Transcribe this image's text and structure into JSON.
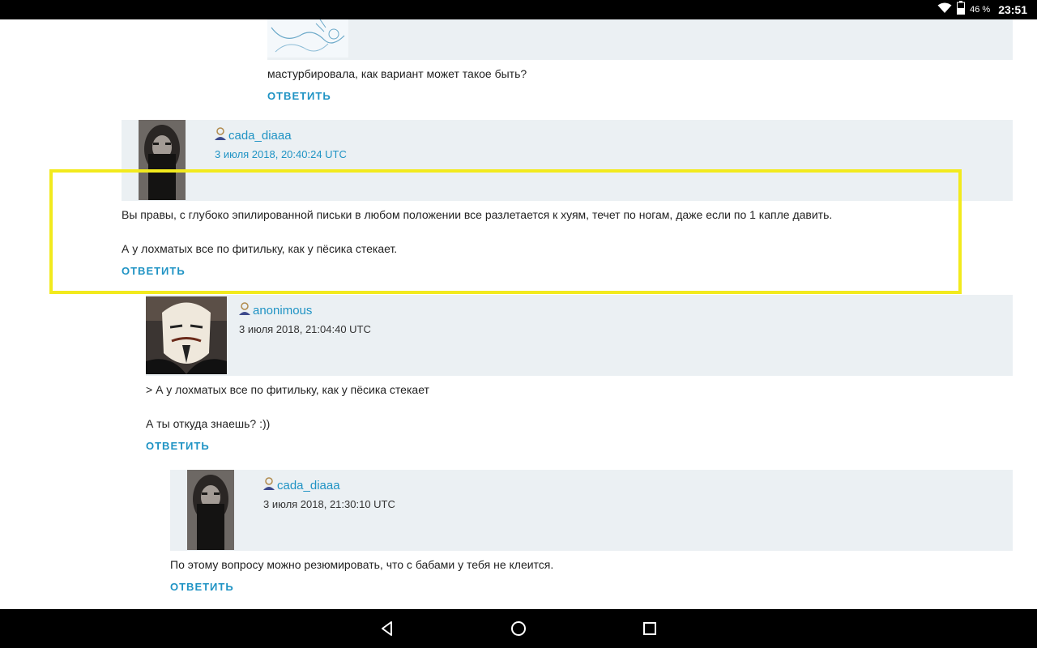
{
  "status_bar": {
    "battery": "46 %",
    "time": "23:51"
  },
  "comments": [
    {
      "text": "мастурбировала, как вариант может такое быть?",
      "reply": "ОТВЕТИТЬ"
    },
    {
      "username": "cada_diaaa",
      "date": "3 июля 2018, 20:40:24 UTC",
      "lines": [
        "Вы правы, с глубоко эпилированной письки в любом положении все разлетается к хуям, течет по ногам, даже если по 1 капле давить.",
        "А у лохматых все по фитильку, как у пёсика стекает."
      ],
      "reply": "ОТВЕТИТЬ"
    },
    {
      "username": "anonimous",
      "date": "3 июля 2018, 21:04:40 UTC",
      "lines": [
        "> А у лохматых все по фитильку, как у пёсика стекает",
        "А ты откуда знаешь? :))"
      ],
      "reply": "ОТВЕТИТЬ"
    },
    {
      "username": "cada_diaaa",
      "date": "3 июля 2018, 21:30:10 UTC",
      "lines": [
        "По этому вопросу можно резюмировать, что с бабами у тебя не клеится."
      ],
      "reply": "ОТВЕТИТЬ"
    }
  ],
  "icons": {
    "user": "user-icon",
    "wifi": "wifi-icon",
    "battery": "battery-icon",
    "back": "back-icon",
    "home": "home-icon",
    "recents": "recents-icon"
  },
  "colors": {
    "accent": "#1f93c4",
    "header_bg": "#ebf0f3",
    "highlight": "#f2ea1d",
    "bars": "#000000"
  }
}
